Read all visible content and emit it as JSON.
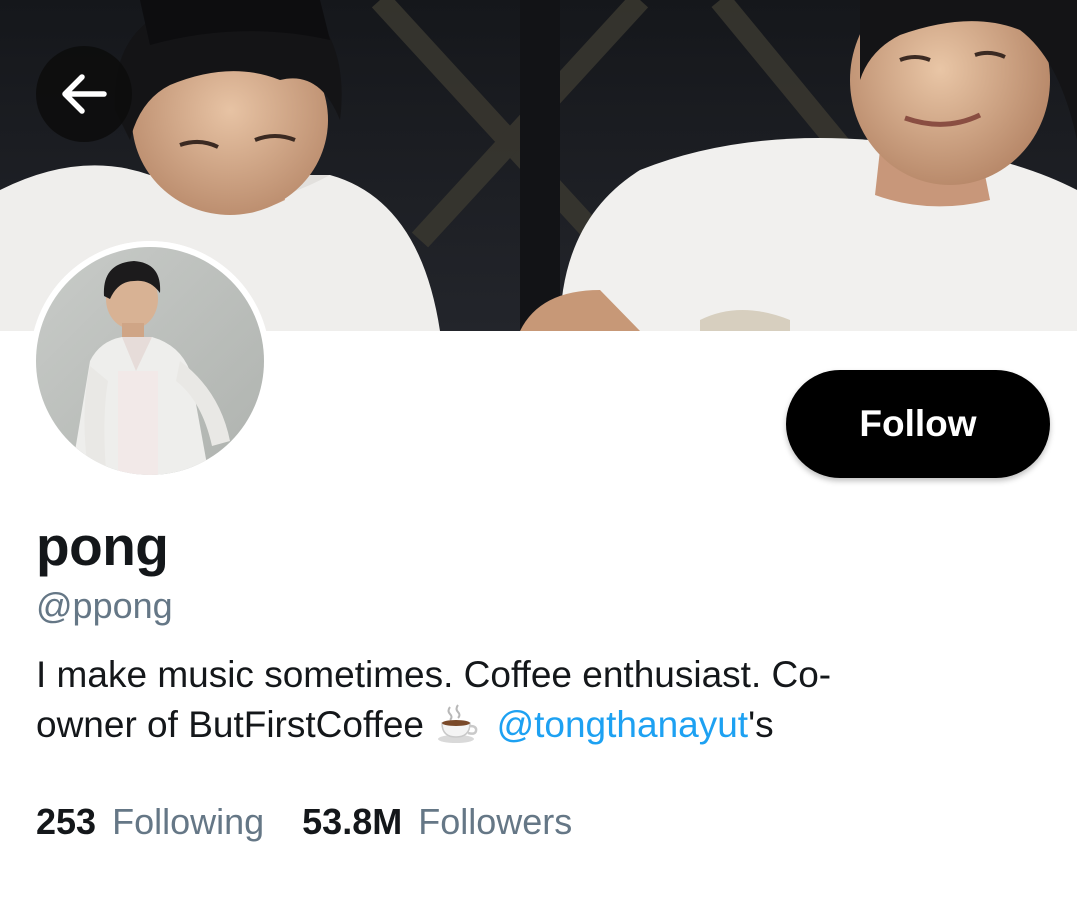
{
  "header": {
    "back_icon": "arrow-left-icon"
  },
  "profile": {
    "display_name": "pong",
    "handle": "@ppong",
    "bio": {
      "line1": "I make music sometimes. Coffee enthusiast. Co-",
      "line2_prefix": "owner of ButFirstCoffee",
      "emoji_icon": "coffee-cup-icon",
      "mention": "@tongthanayut",
      "suffix": "'s"
    },
    "follow_label": "Follow"
  },
  "stats": {
    "following_count": "253",
    "following_label": "Following",
    "followers_count": "53.8M",
    "followers_label": "Followers"
  },
  "colors": {
    "accent_link": "#1da1f2",
    "secondary_text": "#657786",
    "primary_text": "#14171a",
    "follow_button_bg": "#000000"
  }
}
